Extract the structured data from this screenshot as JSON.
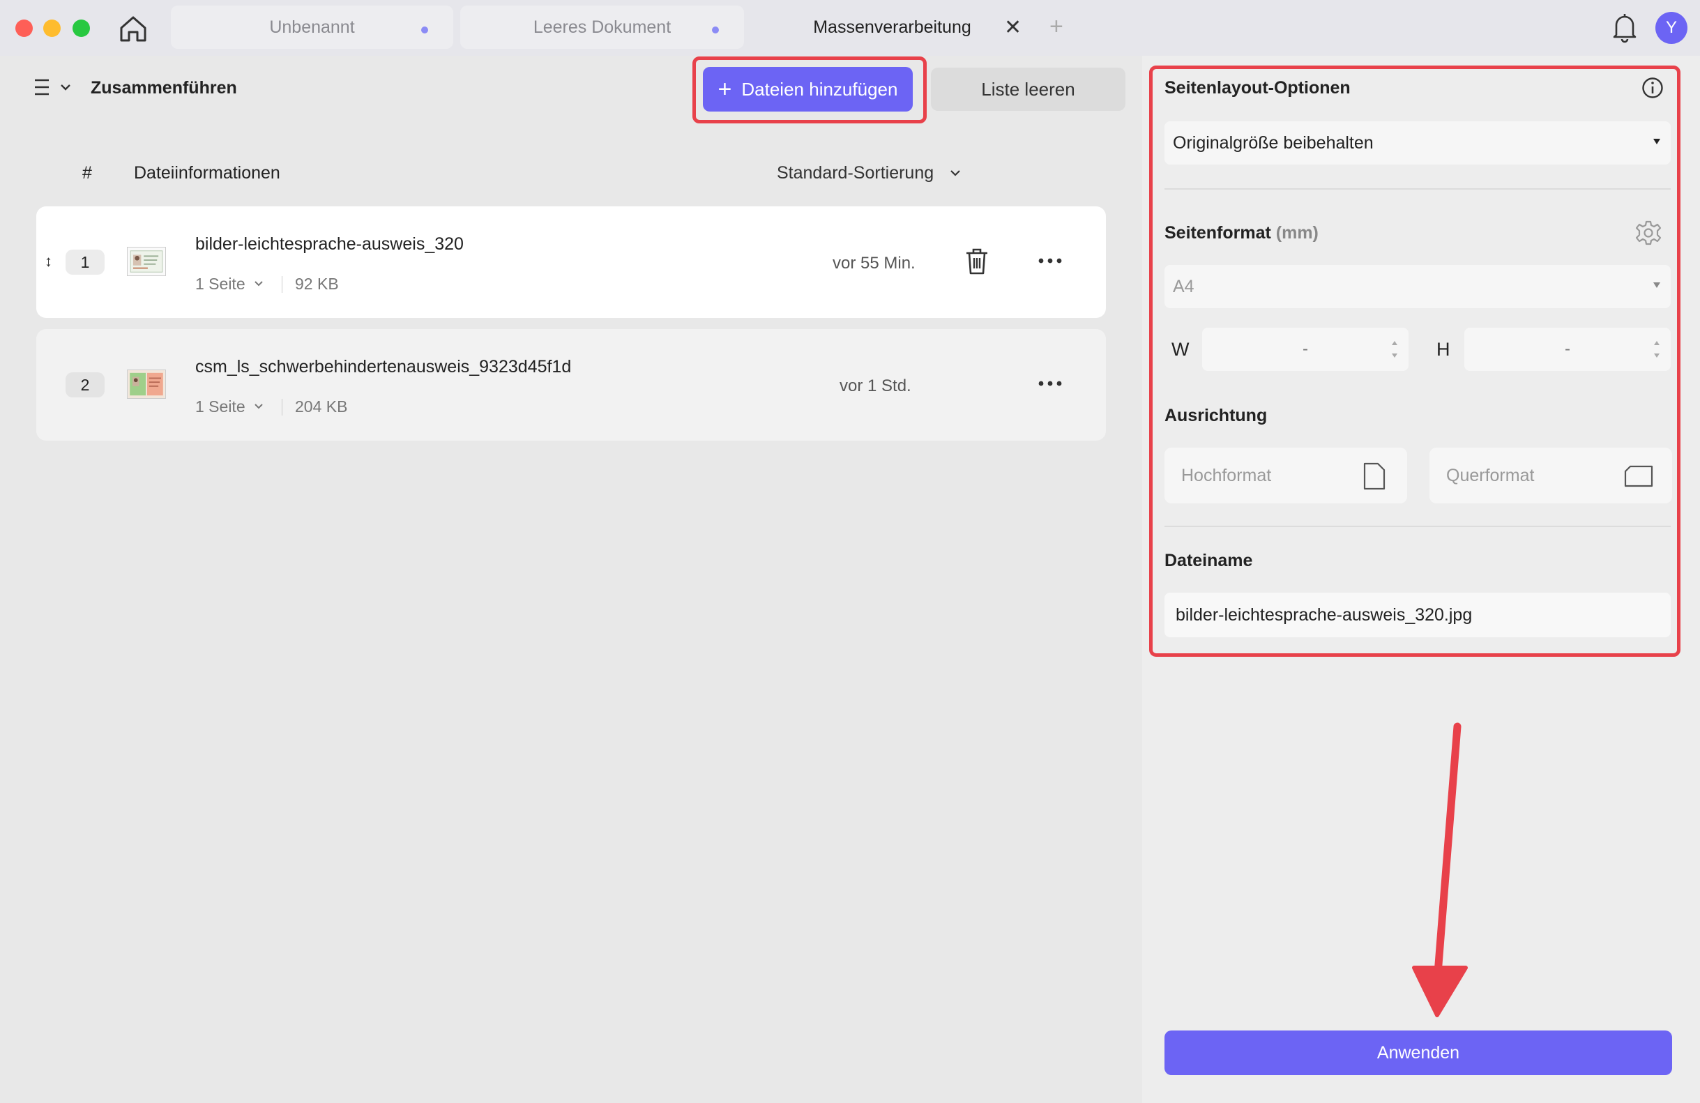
{
  "tabs": [
    {
      "label": "Unbenannt"
    },
    {
      "label": "Leeres Dokument"
    },
    {
      "label": "Massenverarbeitung"
    }
  ],
  "tab_close": "✕",
  "tab_add": "+",
  "user": {
    "avatar_initial": "Y"
  },
  "toolbar": {
    "title": "Zusammenführen",
    "add_files_label": "Dateien hinzufügen",
    "clear_list_label": "Liste leeren"
  },
  "table": {
    "col_number": "#",
    "col_info": "Dateiinformationen",
    "sort_label": "Standard-Sortierung"
  },
  "files": [
    {
      "number": "1",
      "name": "bilder-leichtesprache-ausweis_320",
      "pages": "1 Seite",
      "size": "92 KB",
      "time": "vor 55 Min."
    },
    {
      "number": "2",
      "name": "csm_ls_schwerbehindertenausweis_9323d45f1d",
      "pages": "1 Seite",
      "size": "204 KB",
      "time": "vor 1 Std."
    }
  ],
  "right_panel": {
    "layout_title": "Seitenlayout-Optionen",
    "layout_value": "Originalgröße beibehalten",
    "format_title": "Seitenformat",
    "format_unit": "(mm)",
    "format_value": "A4",
    "width_label": "W",
    "width_value": "-",
    "height_label": "H",
    "height_value": "-",
    "orientation_title": "Ausrichtung",
    "portrait_label": "Hochformat",
    "landscape_label": "Querformat",
    "filename_title": "Dateiname",
    "filename_value": "bilder-leichtesprache-ausweis_320.jpg",
    "apply_label": "Anwenden"
  },
  "colors": {
    "accent": "#6c64f4",
    "annotation": "#e8414a"
  }
}
